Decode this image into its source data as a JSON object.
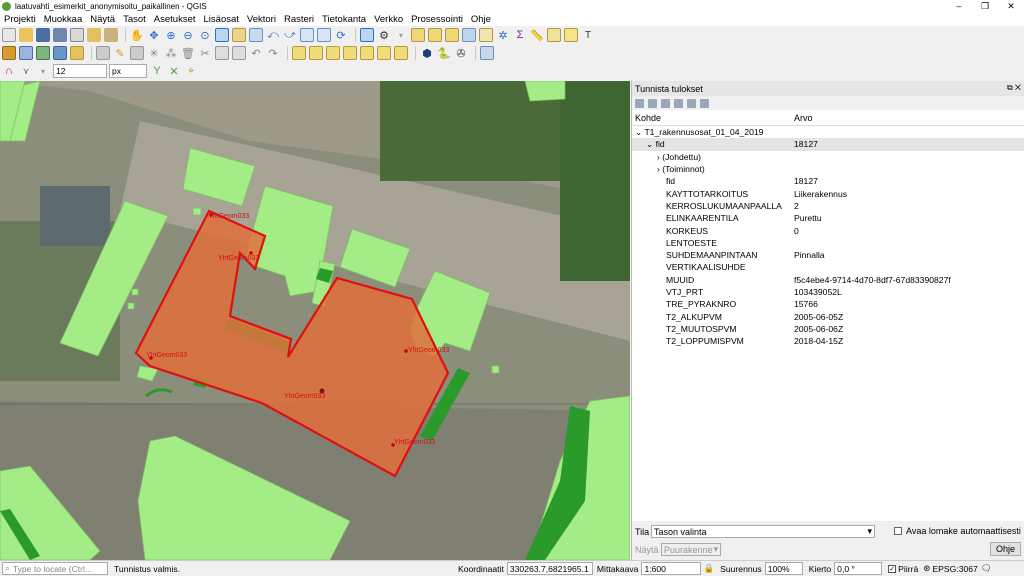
{
  "window": {
    "title": "laatuvahti_esimerkit_anonymisoitu_paikallinen - QGIS",
    "min": "–",
    "max": "❐",
    "close": "✕"
  },
  "menu": [
    "Projekti",
    "Muokkaa",
    "Näytä",
    "Tasot",
    "Asetukset",
    "Lisäosat",
    "Vektori",
    "Rasteri",
    "Tietokanta",
    "Verkko",
    "Prosessointi",
    "Ohje"
  ],
  "snapping": {
    "tolerance": "12",
    "unit": "px"
  },
  "map": {
    "labels": [
      "YhtGeom033",
      "YhtGeom033",
      "YhtGeom033",
      "YhtGeom033",
      "YhtGeom033",
      "YhtGeom033"
    ],
    "colors": {
      "buildings": "#a4ec86",
      "selected_fill": "#e0703c",
      "selected_stroke": "#e01010",
      "dark_green": "#2a9a2a"
    }
  },
  "panel": {
    "title": "Tunnista tulokset",
    "columns": {
      "feature": "Kohde",
      "value": "Arvo"
    },
    "layer": "T1_rakennusosat_01_04_2019",
    "fid_key": "fid",
    "fid_value": "18127",
    "derived": "(Johdettu)",
    "actions": "(Toiminnot)",
    "attributes": [
      {
        "key": "fid",
        "value": "18127"
      },
      {
        "key": "KAYTTOTARKOITUS",
        "value": "Liikerakennus"
      },
      {
        "key": "KERROSLUKUMAANPAALLA",
        "value": "2"
      },
      {
        "key": "ELINKAARENTILA",
        "value": "Purettu"
      },
      {
        "key": "KORKEUS",
        "value": "0"
      },
      {
        "key": "LENTOESTE",
        "value": ""
      },
      {
        "key": "SUHDEMAANPINTAAN",
        "value": "Pinnalla"
      },
      {
        "key": "VERTIKAALISUHDE",
        "value": ""
      },
      {
        "key": "MUUID",
        "value": "f5c4ebe4-9714-4d70-8df7-67d83390827f"
      },
      {
        "key": "VTJ_PRT",
        "value": "103439052L"
      },
      {
        "key": "TRE_PYRAKNRO",
        "value": "15766"
      },
      {
        "key": "T2_ALKUPVM",
        "value": "2005-06-05Z"
      },
      {
        "key": "T2_MUUTOSPVM",
        "value": "2005-06-06Z"
      },
      {
        "key": "T2_LOPPUMISPVM",
        "value": "2018-04-15Z"
      }
    ],
    "mode_label": "Tila",
    "mode_value": "Tason valinta",
    "auto_open_label": "Avaa lomake automaattisesti",
    "view_label": "Näytä",
    "view_value": "Puurakenne",
    "help_button": "Ohje"
  },
  "status": {
    "locate_placeholder": "Type to locate (Ctrl...",
    "message": "Tunnistus valmis.",
    "coord_label": "Koordinaatit",
    "coord_value": "330263.7,6821965.1",
    "scale_label": "Mittakaava",
    "scale_value": "1:600",
    "zoom_label": "Suurennus",
    "zoom_value": "100%",
    "rotation_label": "Kierto",
    "rotation_value": "0,0 °",
    "render_label": "Piirrä",
    "crs": "EPSG:3067"
  }
}
